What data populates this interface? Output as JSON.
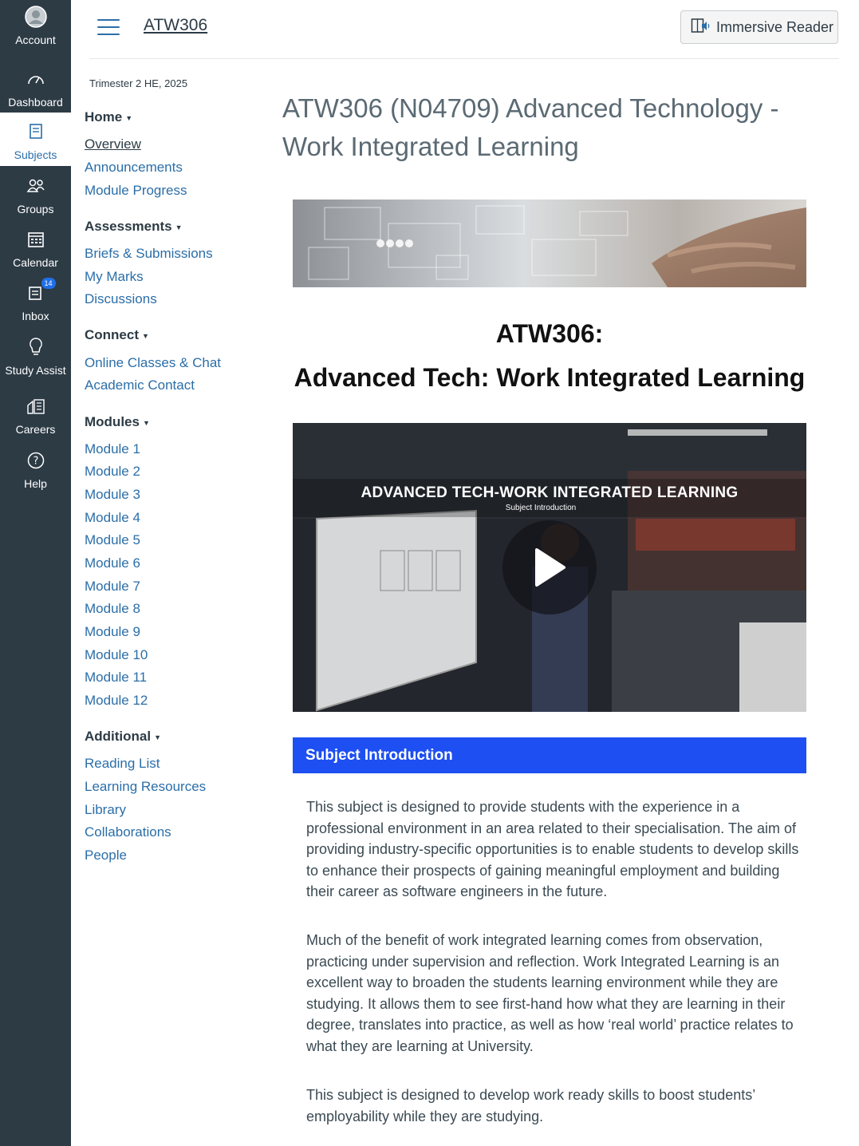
{
  "global_nav": [
    {
      "key": "account",
      "label": "Account",
      "icon": "account-icon"
    },
    {
      "key": "dashboard",
      "label": "Dashboard",
      "icon": "dashboard-icon"
    },
    {
      "key": "subjects",
      "label": "Subjects",
      "icon": "subjects-icon",
      "active": true
    },
    {
      "key": "groups",
      "label": "Groups",
      "icon": "groups-icon"
    },
    {
      "key": "calendar",
      "label": "Calendar",
      "icon": "calendar-icon"
    },
    {
      "key": "inbox",
      "label": "Inbox",
      "icon": "inbox-icon",
      "badge": "14"
    },
    {
      "key": "study-assist",
      "label": "Study Assist",
      "icon": "lightbulb-icon"
    },
    {
      "key": "careers",
      "label": "Careers",
      "icon": "careers-icon"
    },
    {
      "key": "help",
      "label": "Help",
      "icon": "help-icon"
    }
  ],
  "header": {
    "breadcrumb": "ATW306",
    "immersive_reader": "Immersive Reader"
  },
  "course_nav": {
    "term": "Trimester 2 HE, 2025",
    "sections": [
      {
        "title": "Home",
        "links": [
          "Overview",
          "Announcements",
          "Module Progress"
        ]
      },
      {
        "title": "Assessments",
        "links": [
          "Briefs & Submissions",
          "My Marks",
          "Discussions"
        ]
      },
      {
        "title": "Connect",
        "links": [
          "Online Classes & Chat",
          "Academic Contact"
        ]
      },
      {
        "title": "Modules",
        "links": [
          "Module 1",
          "Module 2",
          "Module 3",
          "Module 4",
          "Module 5",
          "Module 6",
          "Module 7",
          "Module 8",
          "Module 9",
          "Module 10",
          "Module 11",
          "Module 12"
        ]
      },
      {
        "title": "Additional",
        "links": [
          "Reading List",
          "Learning Resources",
          "Library",
          "Collaborations",
          "People"
        ]
      }
    ],
    "current": "Overview"
  },
  "main": {
    "page_title": "ATW306 (N04709) Advanced Technology - Work Integrated Learning",
    "heading_line1": "ATW306:",
    "heading_line2": "Advanced Tech: Work Integrated Learning",
    "video_title": "ADVANCED TECH-WORK INTEGRATED LEARNING",
    "video_subtitle": "Subject Introduction",
    "intro_heading": "Subject Introduction",
    "paragraphs": [
      "This subject is designed to provide students with the experience in a professional environment in an area related to their specialisation. The aim of providing industry-specific opportunities is to enable students to develop skills to enhance their prospects of gaining meaningful employment and building their career as software engineers in the future.",
      "Much of the benefit of work integrated learning comes from observation, practicing under supervision and reflection. Work Integrated Learning is an excellent way to broaden the students learning environment while they are studying. It allows them to see first-hand how what they are learning in their degree, translates into practice, as well as how ‘real world’ practice relates to what they are learning at University.",
      "This subject is designed to develop work ready skills to boost students’ employability while they are studying."
    ]
  },
  "colors": {
    "global_nav_bg": "#2d3b45",
    "link": "#2b6ea8",
    "intro_bar": "#1d4ff2",
    "badge": "#1f6feb"
  }
}
